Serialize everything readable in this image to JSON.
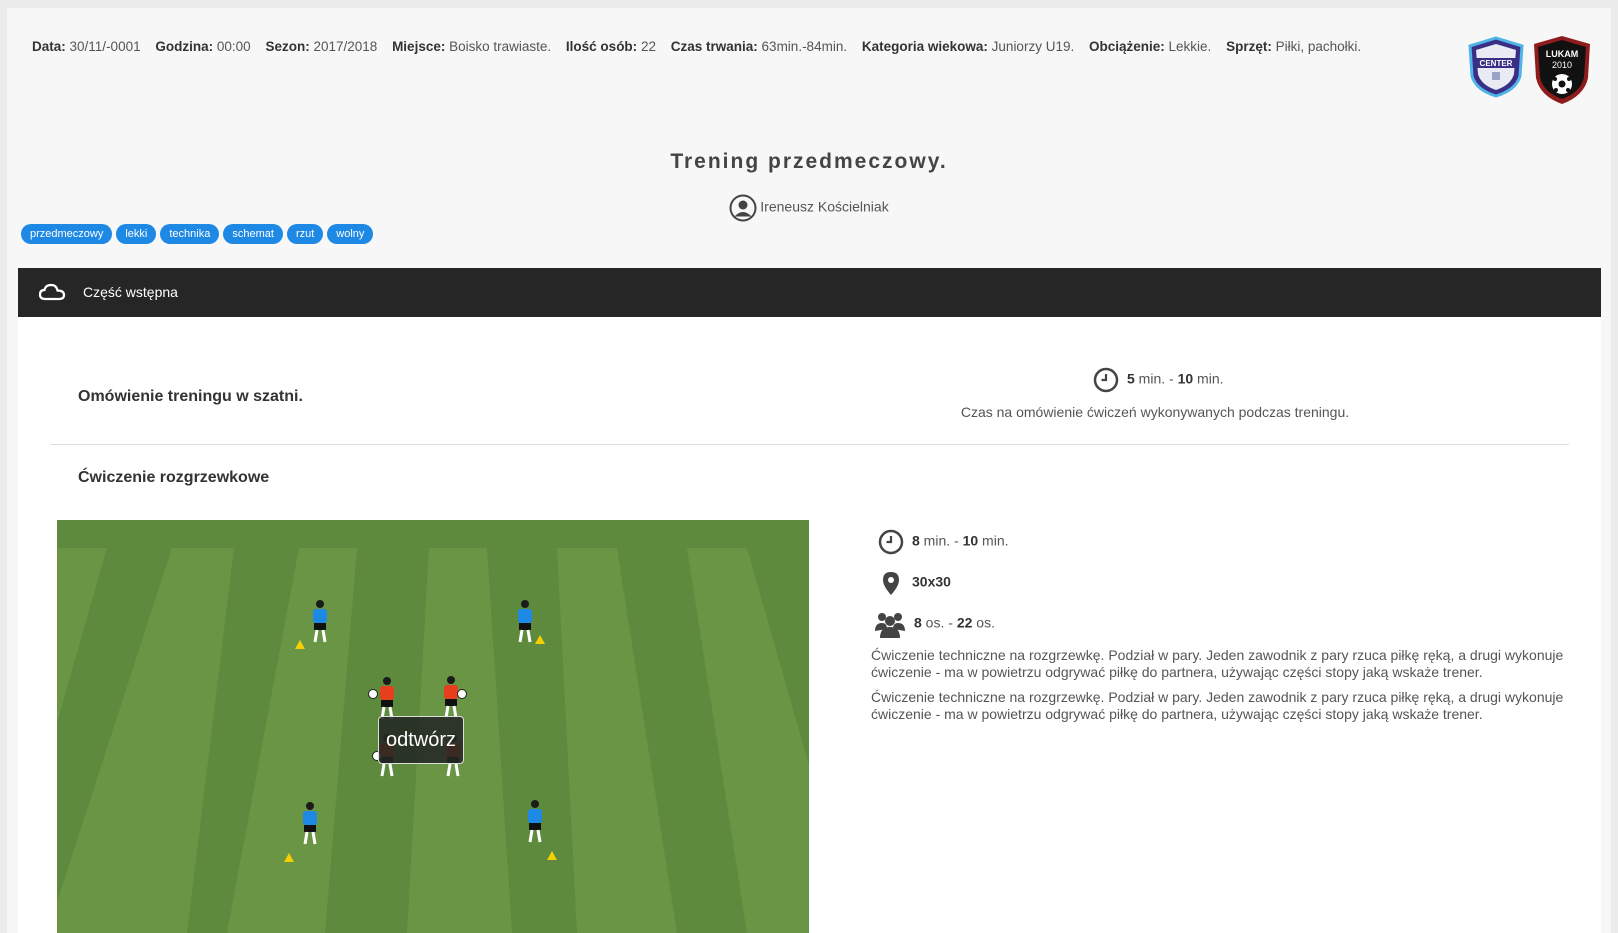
{
  "meta": [
    {
      "label": "Data:",
      "value": "30/11/-0001"
    },
    {
      "label": "Godzina:",
      "value": "00:00"
    },
    {
      "label": "Sezon:",
      "value": "2017/2018"
    },
    {
      "label": "Miejsce:",
      "value": "Boisko trawiaste."
    },
    {
      "label": "Ilość osób:",
      "value": "22"
    },
    {
      "label": "Czas trwania:",
      "value": "63min.-84min."
    },
    {
      "label": "Kategoria wiekowa:",
      "value": "Juniorzy U19."
    },
    {
      "label": "Obciążenie:",
      "value": "Lekkie."
    },
    {
      "label": "Sprzęt:",
      "value": "Piłki, pachołki."
    }
  ],
  "logos": {
    "center": "CENTER",
    "club": "LUKAM",
    "club_year": "2010"
  },
  "title": "Trening przedmeczowy.",
  "author": "Ireneusz Kościelniak",
  "tags": [
    "przedmeczowy",
    "lekki",
    "technika",
    "schemat",
    "rzut",
    "wolny"
  ],
  "section": {
    "icon": "cloud-icon",
    "title": "Część wstępna"
  },
  "exercise1": {
    "title": "Omówienie treningu w szatni.",
    "time_min": "5",
    "time_sep": " min. - ",
    "time_max": "10",
    "time_unit": " min.",
    "description": "Czas na omówienie ćwiczeń wykonywanych podczas treningu."
  },
  "exercise2": {
    "title": "Ćwiczenie rozgrzewkowe",
    "play_label": "odtwórz",
    "time_min": "8",
    "time_sep": " min. - ",
    "time_max": "10",
    "time_unit": " min.",
    "field_size": "30x30",
    "players_min": "8",
    "players_sep": " os. - ",
    "players_max": "22",
    "players_unit": " os.",
    "description_1": "Ćwiczenie techniczne na rozgrzewkę. Podział w pary. Jeden zawodnik z pary rzuca piłkę ręką, a drugi wykonuje ćwiczenie - ma w powietrzu odgrywać piłkę do partnera, używając części stopy jaką wskaże trener.",
    "description_2": "Ćwiczenie techniczne na rozgrzewkę. Podział w pary. Jeden zawodnik z pary rzuca piłkę ręką, a drugi wykonuje ćwiczenie - ma w powietrzu odgrywać piłkę do partnera, używając części stopy jaką wskaże trener."
  },
  "colors": {
    "tag": "#1e88e5",
    "bar": "#262626",
    "pitch": "#5d8a3c",
    "blue_player": "#1e88e5",
    "red_player": "#e53f1e",
    "cone": "#f5d000"
  }
}
